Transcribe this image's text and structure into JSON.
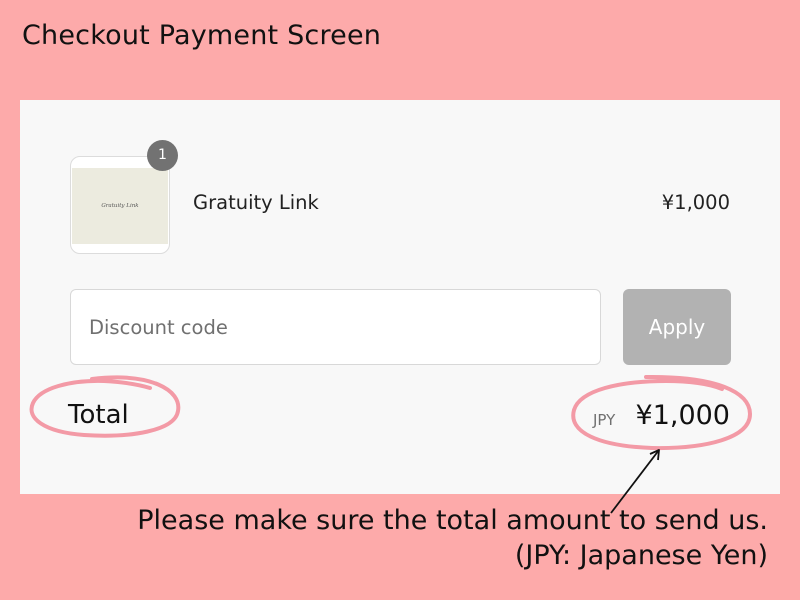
{
  "heading": "Checkout Payment Screen",
  "product": {
    "thumbnail_text": "Gratuity Link",
    "quantity": "1",
    "name": "Gratuity Link",
    "price": "¥1,000"
  },
  "discount": {
    "placeholder": "Discount code",
    "apply_label": "Apply"
  },
  "total": {
    "label": "Total",
    "currency_code": "JPY",
    "amount": "¥1,000"
  },
  "annotation": {
    "line1": "Please make sure the total amount to send us.",
    "line2": "(JPY: Japanese Yen)"
  },
  "colors": {
    "background": "#fdaaaa",
    "panel": "#f8f8f8",
    "highlight_circle": "#f39aa6",
    "apply_button": "#b2b2b2",
    "badge": "#727272"
  }
}
